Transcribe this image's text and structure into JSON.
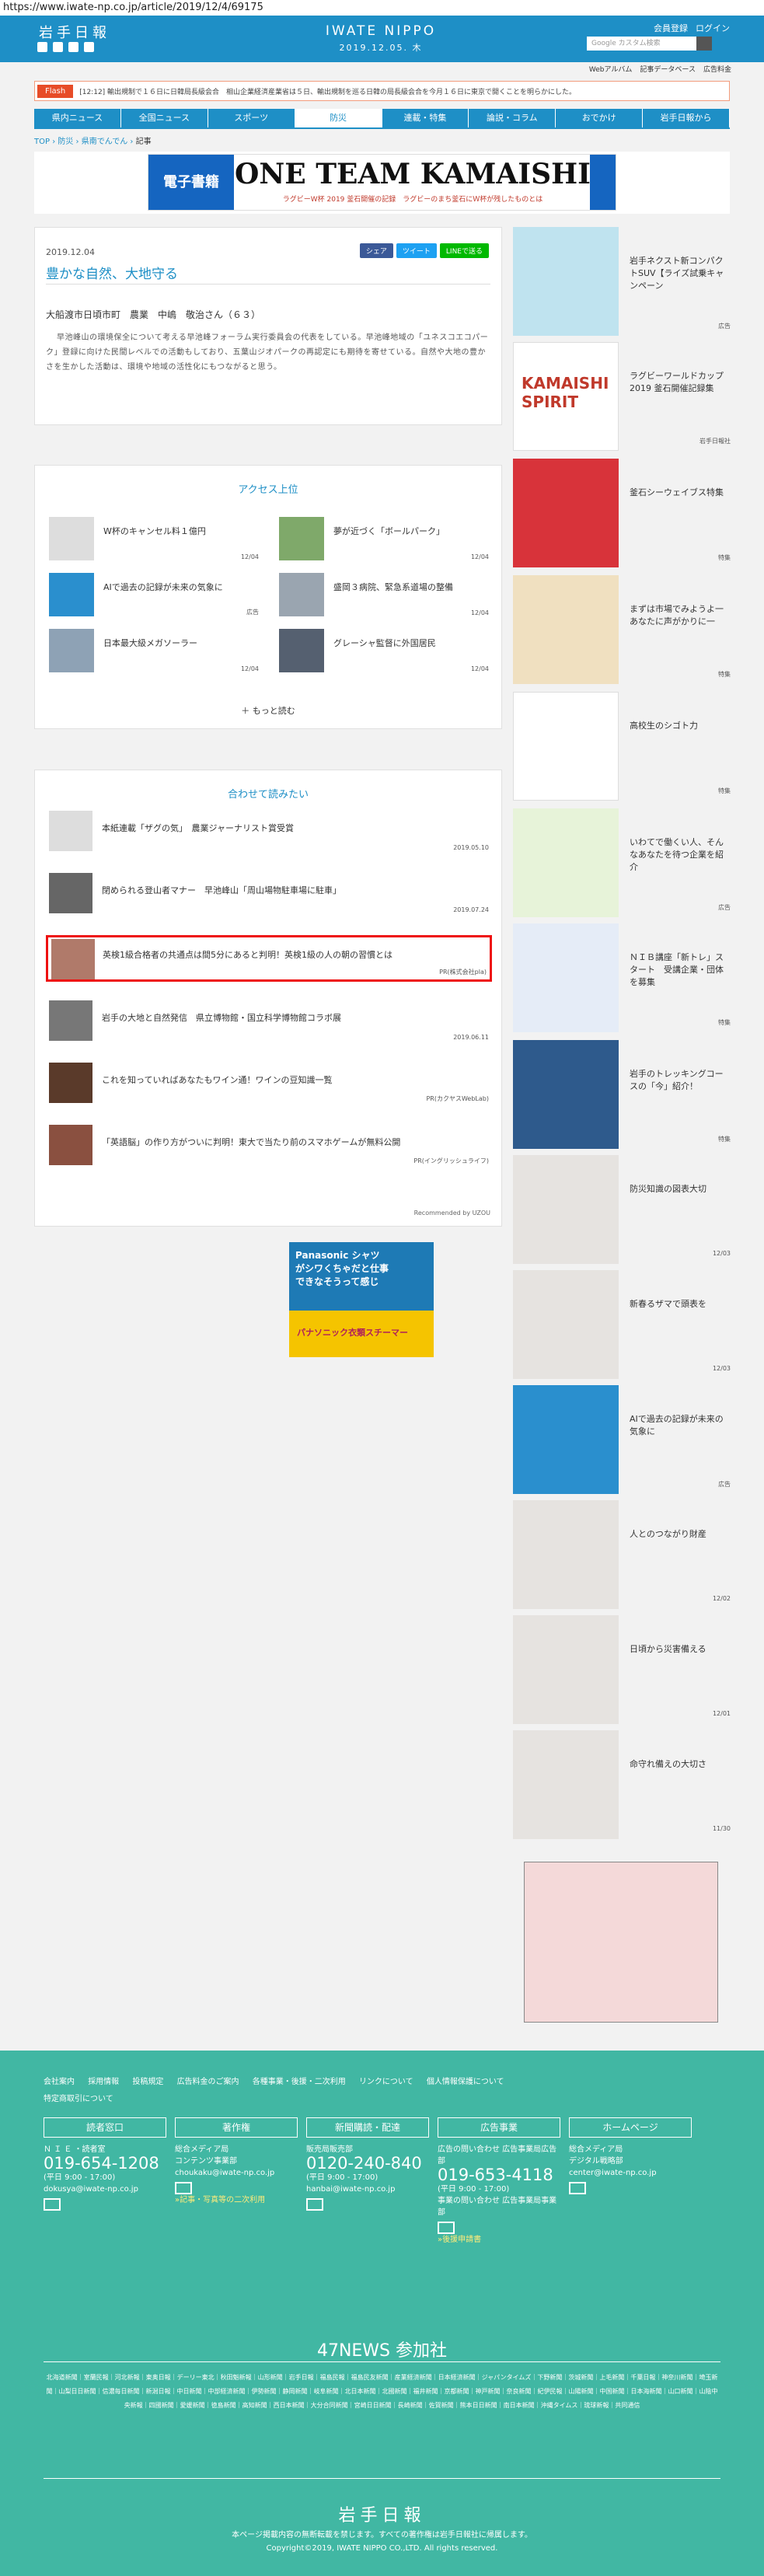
{
  "url": "https://www.iwate-np.co.jp/article/2019/12/4/69175",
  "header": {
    "logo": "岩手日報",
    "brand_en": "IWATE NIPPO",
    "date": "2019.12.05. 木",
    "links": [
      "会員登録",
      "ログイン"
    ],
    "search_placeholder": "Google カスタム検索",
    "sub_links": [
      "Webアルバム",
      "記事データベース",
      "広告料金"
    ]
  },
  "flash": {
    "label": "Flash",
    "text": "[12:12] 輸出規制で１６日に日韓局長級会合　相山企業経済産業省は５日、輸出規制を巡る日韓の局長級会合を今月１６日に東京で開くことを明らかにした。"
  },
  "nav": [
    "県内ニュース",
    "全国ニュース",
    "スポーツ",
    "防災",
    "連載・特集",
    "論説・コラム",
    "おでかけ",
    "岩手日報から"
  ],
  "breadcrumb": [
    "TOP",
    "防災",
    "県南でんでん",
    "記事"
  ],
  "banner": {
    "left": "電子書籍",
    "title": "ONE TEAM KAMAISHI",
    "sub": "ラグビーW杯 2019 釜石開催の記録　ラグビーのまち釜石にＷ杯が残したものとは"
  },
  "article": {
    "date": "2019.12.04",
    "share": [
      "シェア",
      "ツイート",
      "LINEで送る"
    ],
    "title": "豊かな自然、大地守る",
    "meta": "大船渡市日頃市町　農業　中嶋　敬治さん（６３）",
    "body": "早池峰山の環境保全について考える早池峰フォーラム実行委員会の代表をしている。早池峰地域の「ユネスコエコパーク」登録に向けた民間レベルでの活動もしており、五葉山ジオパークの再認定にも期待を寄せている。自然や大地の豊かさを生かした活動は、環境や地域の活性化にもつながると思う。"
  },
  "access": {
    "title": "アクセス上位",
    "items": [
      {
        "t": "W杯のキャンセル料１億円",
        "d": "12/04"
      },
      {
        "t": "夢が近づく「ボールパーク」",
        "d": "12/04"
      },
      {
        "t": "AIで過去の記録が未来の気象に",
        "d": "広告"
      },
      {
        "t": "盛岡３病院、緊急系道場の整備",
        "d": "12/04"
      },
      {
        "t": "日本最大級メガソーラー",
        "d": "12/04"
      },
      {
        "t": "グレーシャ監督に外国居民",
        "d": "12/04"
      }
    ],
    "more": "もっと読む"
  },
  "related": {
    "title": "合わせて読みたい",
    "items": [
      {
        "t": "本紙連載「ザグの気」　農業ジャーナリスト賞受賞",
        "d": "2019.05.10"
      },
      {
        "t": "閉められる登山者マナー　早池峰山「周山場物駐車場に駐車」",
        "d": "2019.07.24"
      },
      {
        "t": "英検1級合格者の共通点は間5分にあると判明！英検1級の人の朝の習慣とは",
        "d": "PR(株式会社pla)"
      },
      {
        "t": "岩手の大地と自然発信　県立博物館・国立科学博物館コラボ展",
        "d": "2019.06.11"
      },
      {
        "t": "これを知っていればあなたもワイン通！ワインの豆知識一覧",
        "d": "PR(カクヤスWebLab)"
      },
      {
        "t": "「英語脳」の作り方がついに判明！東大で当たり前のスマホゲームが無料公開",
        "d": "PR(イングリッシュライフ)"
      }
    ],
    "recommended": "Recommended by UZOU"
  },
  "ad_bottom": {
    "text": "Panasonic シャツがシワくちゃだと仕事できなそうって感じ",
    "sub": "パナソニック衣類スチーマー"
  },
  "sidebar": [
    {
      "t": "岩手ネクスト新コンパクトSUV【ライズ試乗キャンペーン",
      "d": "広告"
    },
    {
      "t": "ラグビーワールドカップ2019 釜石開催記録集",
      "d": "岩手日報社"
    },
    {
      "t": "釜石シーウェイブス特集",
      "d": "特集"
    },
    {
      "t": "まずは市場でみようよ一あなたに声がかりに一",
      "d": "特集"
    },
    {
      "t": "高校生のシゴト力",
      "d": "特集"
    },
    {
      "t": "いわてで働くい人、そんなあなたを待つ企業を紹介",
      "d": "広告"
    },
    {
      "t": "ＮＩＢ講座「新トレ」スタート　受講企業・団体を募集",
      "d": "特集"
    },
    {
      "t": "岩手のトレッキングコースの「今」紹介！",
      "d": "特集"
    },
    {
      "t": "防災知識の図表大切",
      "d": "12/03"
    },
    {
      "t": "新春るザマで頭表を",
      "d": "12/03"
    },
    {
      "t": "AIで過去の記録が未来の気象に",
      "d": "広告"
    },
    {
      "t": "人とのつながり財産",
      "d": "12/02"
    },
    {
      "t": "日頃から災害備える",
      "d": "12/01"
    },
    {
      "t": "命守れ備えの大切さ",
      "d": "11/30"
    }
  ],
  "footer": {
    "links": [
      "会社案内",
      "採用情報",
      "投稿規定",
      "広告料金のご案内",
      "各種事業・後援・二次利用",
      "リンクについて",
      "個人情報保護について",
      "特定商取引について"
    ],
    "cols": [
      {
        "h": "読者窓口",
        "b1": "Ｎ Ｉ Ｅ ・読者室",
        "tel": "019-654-1208",
        "b2": "(平日 9:00 - 17:00)",
        "b3": "dokusya@iwate-np.co.jp"
      },
      {
        "h": "著作権",
        "b1": "総合メディア局",
        "tel": "",
        "b2": "コンテンツ事業部",
        "b3": "choukaku@iwate-np.co.jp",
        "b4": "»記事・写真等の二次利用"
      },
      {
        "h": "新聞購読・配達",
        "b1": "販売局販売部",
        "tel": "0120-240-840",
        "b2": "(平日 9:00 - 17:00)",
        "b3": "hanbai@iwate-np.co.jp"
      },
      {
        "h": "広告事業",
        "b1": "広告の問い合わせ 広告事業局広告部",
        "tel": "019-653-4118",
        "b2": "(平日 9:00 - 17:00)",
        "b3": "事業の問い合わせ 広告事業局事業部",
        "b4": "»後援申請書"
      },
      {
        "h": "ホームページ",
        "b1": "総合メディア局",
        "tel": "",
        "b2": "デジタル戦略部",
        "b3": "center@iwate-np.co.jp"
      }
    ],
    "n47": "47NEWS 参加社",
    "n47_list": "北海道新聞｜室蘭民報｜河北新報｜東奥日報｜デーリー東北｜秋田魁新報｜山形新聞｜岩手日報｜福島民報｜福島民友新聞｜産業経済新聞｜日本経済新聞｜ジャパンタイムズ｜下野新聞｜茨城新聞｜上毛新聞｜千葉日報｜神奈川新聞｜埼玉新聞｜山梨日日新聞｜信濃毎日新聞｜新潟日報｜中日新聞｜中部経済新聞｜伊勢新聞｜静岡新聞｜岐阜新聞｜北日本新聞｜北國新聞｜福井新聞｜京都新聞｜神戸新聞｜奈良新聞｜紀伊民報｜山陽新聞｜中国新聞｜日本海新聞｜山口新聞｜山陰中央新報｜四國新聞｜愛媛新聞｜徳島新聞｜高知新聞｜西日本新聞｜大分合同新聞｜宮崎日日新聞｜長崎新聞｜佐賀新聞｜熊本日日新聞｜南日本新聞｜沖縄タイムス｜琉球新報｜共同通信",
    "logo": "岩手日報",
    "copy1": "本ページ掲載内容の無断転載を禁じます。すべての著作権は岩手日報社に帰属します。",
    "copy2": "Copyright©2019, IWATE NIPPO CO.,LTD. All rights reserved."
  }
}
